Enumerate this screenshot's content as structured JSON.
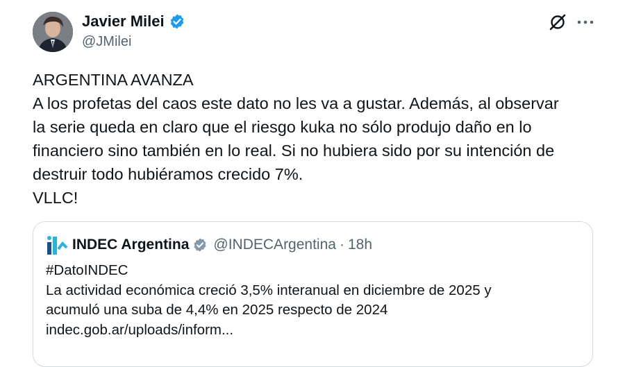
{
  "tweet": {
    "author_name": "Javier Milei",
    "author_handle": "@JMilei",
    "lines": [
      "ARGENTINA AVANZA",
      "A los profetas del caos este dato no les va a gustar. Además, al observar",
      "la serie queda en claro que el riesgo kuka no sólo produjo daño en lo",
      "financiero sino también en lo real. Si no hubiera sido por su intención de",
      "destruir todo hubiéramos crecido 7%.",
      "VLLC!"
    ]
  },
  "quote": {
    "author_name": "INDEC Argentina",
    "author_handle": "@INDECArgentina",
    "separator": "·",
    "time": "18h",
    "lines": [
      "#DatoINDEC",
      "La actividad económica creció 3,5% interanual en diciembre de 2025 y",
      "acumuló una suba de 4,4% en 2025 respecto de 2024",
      "indec.gob.ar/uploads/inform..."
    ]
  },
  "icons": {
    "verified": "verified-badge-icon",
    "grok": "grok-icon",
    "more": "more-icon"
  },
  "colors": {
    "verified_blue": "#1d9bf0",
    "secondary_text": "#536471",
    "border": "#cfd9de"
  }
}
